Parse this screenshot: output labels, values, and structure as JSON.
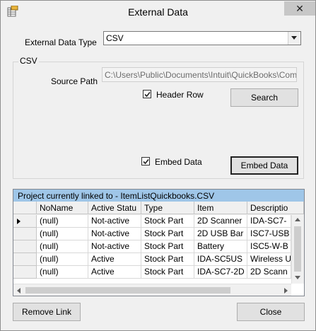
{
  "window": {
    "title": "External Data"
  },
  "external_data_type": {
    "label": "External Data Type",
    "value": "CSV"
  },
  "csv_group": {
    "legend": "CSV",
    "source_path_label": "Source Path",
    "source_path_value": "C:\\Users\\Public\\Documents\\Intuit\\QuickBooks\\Com",
    "header_row_label": "Header Row",
    "header_row_checked": true,
    "search_label": "Search",
    "embed_data_checkbox_label": "Embed Data",
    "embed_data_checked": true,
    "embed_data_button_label": "Embed Data"
  },
  "grid": {
    "caption": "Project currently linked to - ItemListQuickbooks.CSV",
    "columns": [
      "NoName",
      "Active Statu",
      "Type",
      "Item",
      "Descriptio"
    ],
    "rows": [
      {
        "current": true,
        "cells": [
          "(null)",
          "Not-active",
          "Stock Part",
          "2D Scanner",
          "IDA-SC7-"
        ]
      },
      {
        "current": false,
        "cells": [
          "(null)",
          "Not-active",
          "Stock Part",
          "2D USB Bar",
          "ISC7-USB"
        ]
      },
      {
        "current": false,
        "cells": [
          "(null)",
          "Not-active",
          "Stock Part",
          "Battery",
          "ISC5-W-B"
        ]
      },
      {
        "current": false,
        "cells": [
          "(null)",
          "Active",
          "Stock Part",
          "IDA-SC5US",
          "Wireless U"
        ]
      },
      {
        "current": false,
        "cells": [
          "(null)",
          "Active",
          "Stock Part",
          "IDA-SC7-2D",
          "2D Scann"
        ]
      }
    ]
  },
  "footer": {
    "remove_link_label": "Remove Link",
    "close_label": "Close"
  },
  "icons": {
    "app": "table-icon",
    "close": "close-icon",
    "dropdown": "chevron-down-icon",
    "current_row": "row-pointer-icon"
  },
  "colors": {
    "caption_bg": "#9fc6e8",
    "close_btn_bg": "#c7c7c7"
  }
}
